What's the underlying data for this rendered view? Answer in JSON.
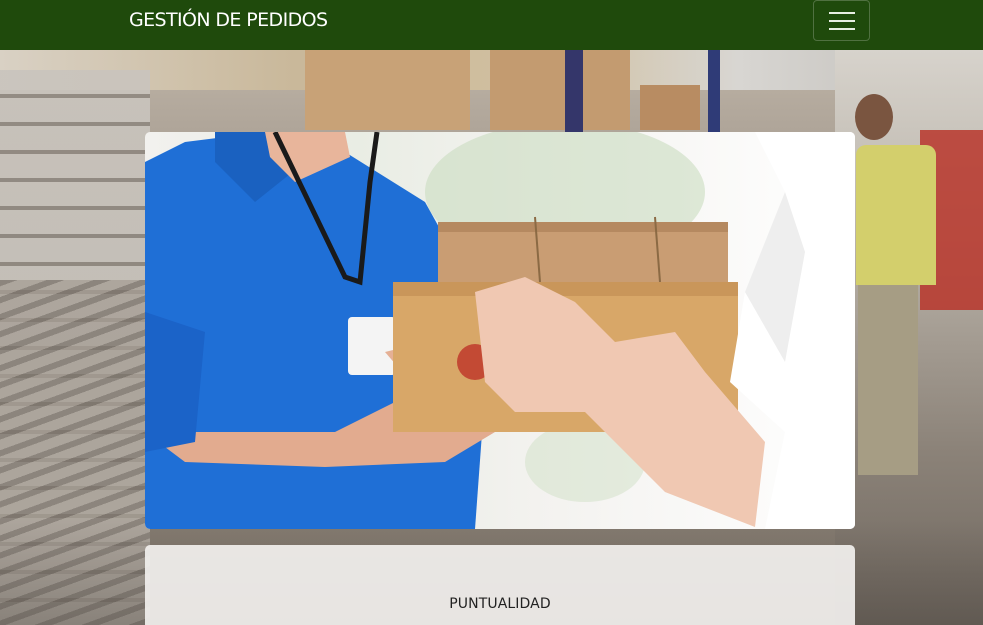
{
  "navbar": {
    "brand": "GESTIÓN DE PEDIDOS",
    "toggler_icon": "hamburger-menu-icon",
    "bg_color": "#1f4a0c"
  },
  "hero": {
    "image_subject": "courier-delivering-boxes-photo"
  },
  "features": {
    "first_title": "PUNTUALIDAD"
  }
}
